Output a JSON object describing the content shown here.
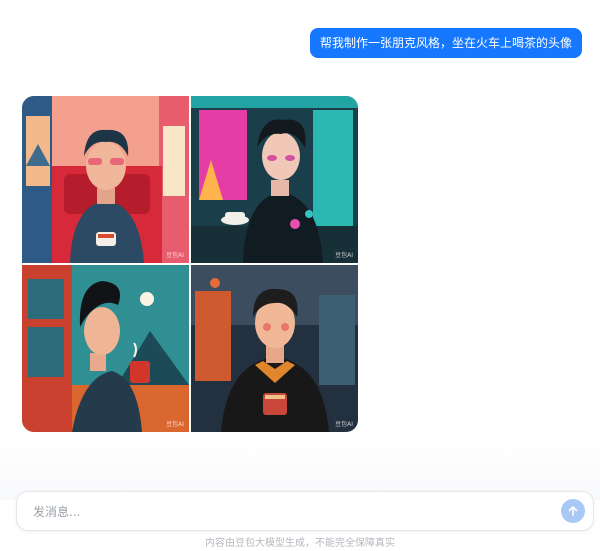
{
  "user_message": "帮我制作一张朋克风格，坐在火车上喝茶的头像",
  "images": [
    {
      "watermark": "豆包AI"
    },
    {
      "watermark": "豆包AI"
    },
    {
      "watermark": "豆包AI"
    },
    {
      "watermark": "豆包AI"
    }
  ],
  "composer": {
    "placeholder": "发消息...",
    "send_icon": "arrow-up-icon"
  },
  "disclaimer": "内容由豆包大模型生成，不能完全保障真实",
  "colors": {
    "accent": "#1677ff",
    "send_disabled": "#a9c8f5"
  }
}
